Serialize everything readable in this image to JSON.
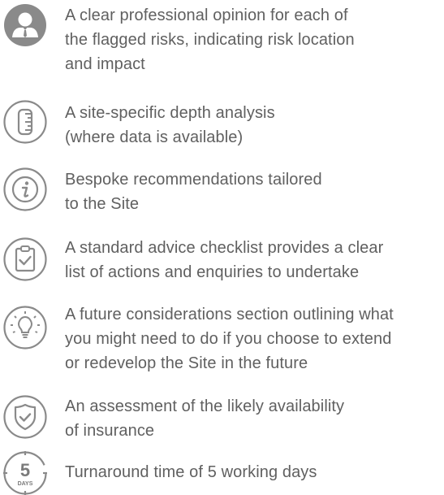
{
  "features": [
    {
      "icon": "professional-person-icon",
      "line1": "A clear professional opinion for each of",
      "line2": "the flagged risks, indicating risk location",
      "line3": "and impact"
    },
    {
      "icon": "depth-ruler-icon",
      "line1": "A site-specific depth analysis",
      "line2": "(where data is available)"
    },
    {
      "icon": "info-icon",
      "line1": "Bespoke recommendations tailored",
      "line2": "to the Site"
    },
    {
      "icon": "clipboard-check-icon",
      "line1": "A standard advice checklist provides a clear",
      "line2": "list of actions and enquiries to undertake"
    },
    {
      "icon": "lightbulb-icon",
      "line1": "A future considerations section outlining what",
      "line2": "you might need to do if you choose to extend",
      "line3": "or redevelop the Site in the future"
    },
    {
      "icon": "shield-check-icon",
      "line1": "An assessment of the likely availability",
      "line2": "of insurance"
    },
    {
      "icon": "stopwatch-5-days-icon",
      "badge_number": "5",
      "badge_unit": "DAYS",
      "line1": "Turnaround time of 5 working days"
    }
  ]
}
